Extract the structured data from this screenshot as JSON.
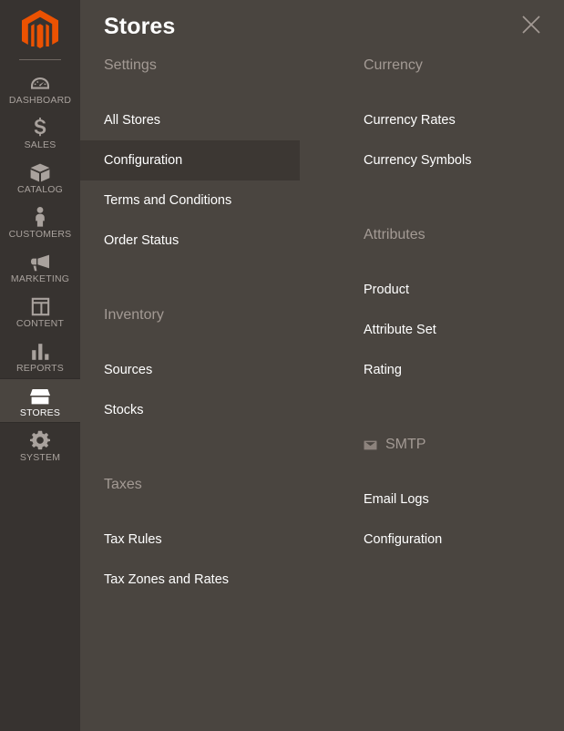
{
  "sidebar": {
    "logo": "magento-logo",
    "items": [
      {
        "label": "DASHBOARD",
        "icon": "dashboard-gauge-icon",
        "active": false
      },
      {
        "label": "SALES",
        "icon": "dollar-sign-icon",
        "active": false
      },
      {
        "label": "CATALOG",
        "icon": "box-icon",
        "active": false
      },
      {
        "label": "CUSTOMERS",
        "icon": "person-icon",
        "active": false
      },
      {
        "label": "MARKETING",
        "icon": "megaphone-icon",
        "active": false
      },
      {
        "label": "CONTENT",
        "icon": "layout-window-icon",
        "active": false
      },
      {
        "label": "REPORTS",
        "icon": "bar-chart-icon",
        "active": false
      },
      {
        "label": "STORES",
        "icon": "storefront-icon",
        "active": true
      },
      {
        "label": "SYSTEM",
        "icon": "gear-icon",
        "active": false
      }
    ]
  },
  "panel": {
    "title": "Stores",
    "close_label": "close-icon",
    "left_column": [
      {
        "title": "Settings",
        "icon": null,
        "items": [
          {
            "label": "All Stores",
            "selected": false
          },
          {
            "label": "Configuration",
            "selected": true
          },
          {
            "label": "Terms and Conditions",
            "selected": false
          },
          {
            "label": "Order Status",
            "selected": false
          }
        ]
      },
      {
        "title": "Inventory",
        "icon": null,
        "items": [
          {
            "label": "Sources",
            "selected": false
          },
          {
            "label": "Stocks",
            "selected": false
          }
        ]
      },
      {
        "title": "Taxes",
        "icon": null,
        "items": [
          {
            "label": "Tax Rules",
            "selected": false
          },
          {
            "label": "Tax Zones and Rates",
            "selected": false
          }
        ]
      }
    ],
    "right_column": [
      {
        "title": "Currency",
        "icon": null,
        "items": [
          {
            "label": "Currency Rates",
            "selected": false
          },
          {
            "label": "Currency Symbols",
            "selected": false
          }
        ]
      },
      {
        "title": "Attributes",
        "icon": null,
        "items": [
          {
            "label": "Product",
            "selected": false
          },
          {
            "label": "Attribute Set",
            "selected": false
          },
          {
            "label": "Rating",
            "selected": false
          }
        ]
      },
      {
        "title": "SMTP",
        "icon": "envelope-icon",
        "items": [
          {
            "label": "Email Logs",
            "selected": false
          },
          {
            "label": "Configuration",
            "selected": false
          }
        ]
      }
    ]
  },
  "colors": {
    "sidebar_bg": "#373330",
    "panel_bg": "#4a4540",
    "selected_bg": "#3c3733",
    "accent_orange": "#eb5202",
    "muted_text": "#a39a94",
    "nav_text": "#a9a29d"
  }
}
